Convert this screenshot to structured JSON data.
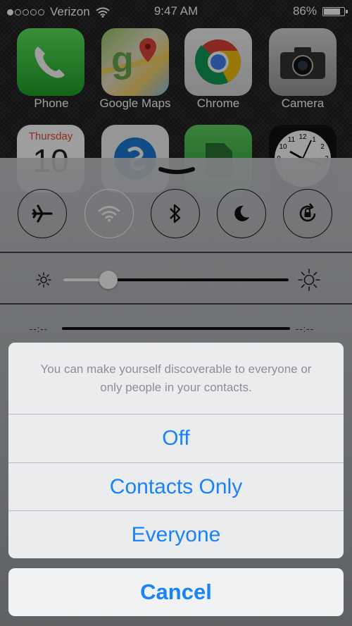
{
  "status_bar": {
    "signal_bars_filled": 1,
    "signal_bars_total": 5,
    "carrier": "Verizon",
    "time": "9:47 AM",
    "battery_percent": "86%",
    "battery_level": 0.86
  },
  "home_screen": {
    "apps_row1": [
      {
        "name": "Phone",
        "icon": "phone-icon"
      },
      {
        "name": "Google Maps",
        "icon": "google-maps-icon"
      },
      {
        "name": "Chrome",
        "icon": "chrome-icon"
      },
      {
        "name": "Camera",
        "icon": "camera-icon"
      }
    ],
    "calendar_day": "Thursday",
    "calendar_date": "10",
    "clock_numerals": [
      "12",
      "1",
      "2",
      "10",
      "11",
      "9",
      "3"
    ]
  },
  "control_center": {
    "toggles": [
      {
        "name": "airplane-mode",
        "icon": "airplane-icon",
        "on": false
      },
      {
        "name": "wifi",
        "icon": "wifi-icon",
        "on": true
      },
      {
        "name": "bluetooth",
        "icon": "bluetooth-icon",
        "on": false
      },
      {
        "name": "do-not-disturb",
        "icon": "moon-icon",
        "on": false
      },
      {
        "name": "rotation-lock",
        "icon": "rotation-lock-icon",
        "on": false
      }
    ],
    "brightness_level": 0.2,
    "media_elapsed": "--:--",
    "media_remaining": "--:--"
  },
  "action_sheet": {
    "message": "You can make yourself discoverable to everyone or only people in your contacts.",
    "options": [
      "Off",
      "Contacts Only",
      "Everyone"
    ],
    "cancel": "Cancel"
  },
  "colors": {
    "accent": "#1a82fb",
    "message_text": "#8e8e93"
  }
}
